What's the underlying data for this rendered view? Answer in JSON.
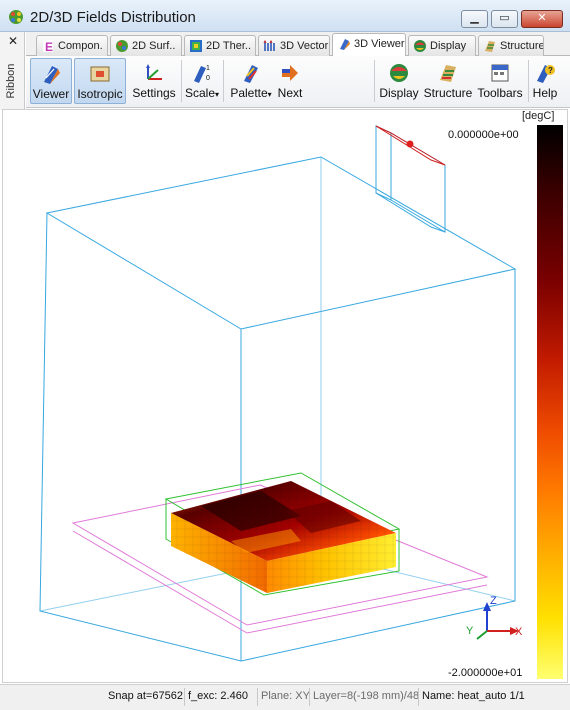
{
  "window": {
    "title": "2D/3D Fields Distribution",
    "buttons": {
      "minimize": "▁",
      "maximize": "▭",
      "close": "✕"
    }
  },
  "ribbon": {
    "close": "✕",
    "label": "Ribbon"
  },
  "tabs": [
    {
      "label": "Compon.",
      "icon": "components-icon"
    },
    {
      "label": "2D Surf..",
      "icon": "surface-2d-icon"
    },
    {
      "label": "2D Ther..",
      "icon": "thermal-2d-icon"
    },
    {
      "label": "3D Vector",
      "icon": "vector-3d-icon"
    },
    {
      "label": "3D Viewer",
      "icon": "viewer-3d-icon",
      "active": true
    },
    {
      "label": "Display",
      "icon": "display-icon"
    },
    {
      "label": "Structure",
      "icon": "structure-icon"
    }
  ],
  "toolbar": {
    "viewer": "Viewer",
    "isotropic": "Isotropic",
    "settings": "Settings",
    "scale": "Scale",
    "palette": "Palette",
    "next": "Next",
    "display": "Display",
    "structure": "Structure",
    "toolbars": "Toolbars",
    "help": "Help"
  },
  "legend": {
    "unit": "[degC]",
    "max": "0.000000e+00",
    "min": "-2.000000e+01",
    "colors": [
      "#000000",
      "#7a0000",
      "#ee4a00",
      "#ffb000",
      "#ffff70"
    ]
  },
  "axes": {
    "z": "Z",
    "y": "Y",
    "x": "X"
  },
  "status": {
    "snap": "Snap at=67562",
    "fexc": "f_exc:  2.460",
    "plane": "Plane: XY",
    "layer": "Layer=8(-198 mm)/48",
    "name": "Name: heat_auto 1/1"
  }
}
